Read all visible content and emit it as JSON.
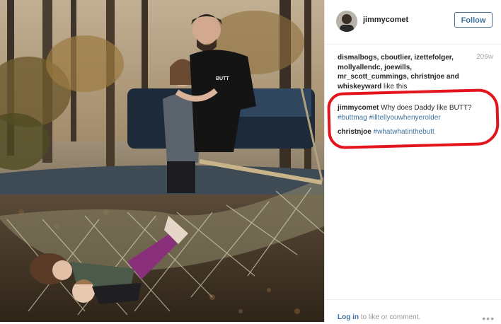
{
  "post": {
    "username": "jimmycomet",
    "follow_label": "Follow",
    "age": "206w",
    "likes_names": "dismalbogs, cboutlier, izettefolger, mollyallendc, joewills, mr_scott_cummings, christnjoe and whiskeyward",
    "likes_suffix": "like this",
    "comments": [
      {
        "user": "jimmycomet",
        "text": "Why does Daddy like BUTT?",
        "tags": "#buttmag #illtellyouwhenyerolder"
      },
      {
        "user": "christnjoe",
        "text": "",
        "tags": "#whatwhatinthebutt"
      }
    ],
    "footer": {
      "login_link": "Log in",
      "login_rest": "to like or comment.",
      "more": "•••"
    }
  },
  "photo": {
    "shirt_text": "BUTT"
  },
  "colors": {
    "link": "#3f729b",
    "annotation": "#e3141c"
  }
}
